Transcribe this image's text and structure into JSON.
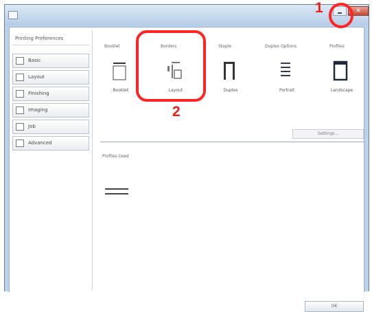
{
  "window": {
    "close_glyph": "✕"
  },
  "sidebar": {
    "header": "Printing Preferences",
    "items": [
      {
        "label": "Basic",
        "icon": "page-icon"
      },
      {
        "label": "Layout",
        "icon": "layout-icon"
      },
      {
        "label": "Finishing",
        "icon": "finishing-icon"
      },
      {
        "label": "Imaging",
        "icon": "imaging-icon"
      },
      {
        "label": "Job",
        "icon": "job-icon"
      },
      {
        "label": "Advanced",
        "icon": "advanced-icon"
      }
    ]
  },
  "ribbon": {
    "columns": [
      "Booklet",
      "Borders",
      "Staple",
      "Duplex Options",
      "Profiles"
    ],
    "presets": [
      {
        "label": "Booklet",
        "icon": "booklet-icon"
      },
      {
        "label": "Layout",
        "icon": "layout-preset-icon"
      },
      {
        "label": "Duplex",
        "icon": "duplex-icon"
      },
      {
        "label": "Portrait",
        "icon": "portrait-icon"
      },
      {
        "label": "Landscape",
        "icon": "landscape-icon"
      }
    ],
    "setting_button": "Settings..."
  },
  "main": {
    "profiles_label": "Profiles Used",
    "ok_label": "OK"
  },
  "callouts": [
    {
      "number": "1",
      "target": "minimize-button"
    },
    {
      "number": "2",
      "target": "preset-layout"
    }
  ],
  "colors": {
    "callout": "#ff2424",
    "titlebar": "#b9d1ea",
    "close_button": "#c54a35"
  }
}
